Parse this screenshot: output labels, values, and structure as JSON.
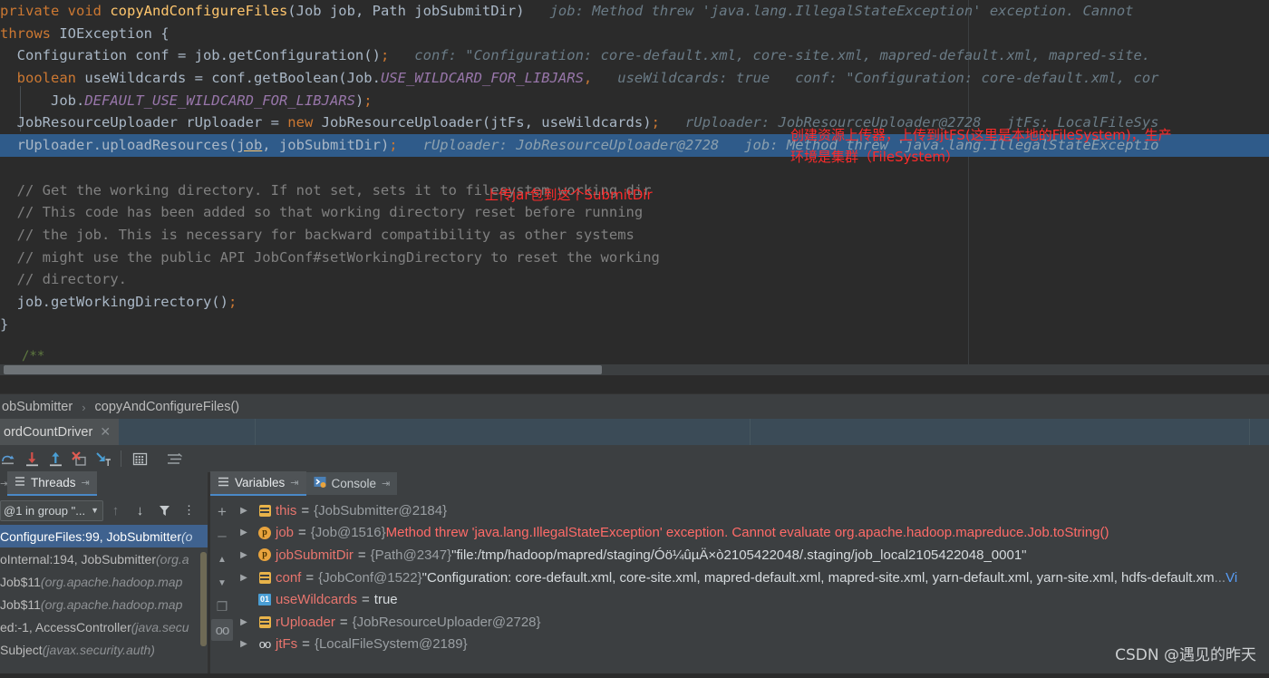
{
  "editor": {
    "lines": [
      {
        "segments": [
          {
            "t": "kw",
            "v": "private void "
          },
          {
            "t": "id",
            "v": "copyAndConfigureFiles"
          },
          {
            "t": "plain",
            "v": "(Job job, Path jobSubmitDir)"
          }
        ],
        "hint": "job: Method threw 'java.lang.IllegalStateException' exception. Cannot"
      },
      {
        "segments": [
          {
            "t": "kw",
            "v": "throws "
          },
          {
            "t": "plain",
            "v": "IOException {"
          }
        ],
        "hint": ""
      },
      {
        "segments": [
          {
            "t": "plain",
            "v": "  Configuration conf = job.getConfiguration()"
          },
          {
            "t": "semi",
            "v": ";"
          }
        ],
        "hint": "conf: \"Configuration: core-default.xml, core-site.xml, mapred-default.xml, mapred-site."
      },
      {
        "segments": [
          {
            "t": "kw",
            "v": "  boolean "
          },
          {
            "t": "plain",
            "v": "useWildcards = conf.getBoolean(Job."
          },
          {
            "t": "stat",
            "v": "USE_WILDCARD_FOR_LIBJARS"
          },
          {
            "t": "semi",
            "v": ","
          }
        ],
        "hint": "useWildcards: true   conf: \"Configuration: core-default.xml, cor"
      },
      {
        "segments": [
          {
            "t": "plain",
            "v": "      Job."
          },
          {
            "t": "stat",
            "v": "DEFAULT_USE_WILDCARD_FOR_LIBJARS"
          },
          {
            "t": "plain",
            "v": ")"
          },
          {
            "t": "semi",
            "v": ";"
          }
        ],
        "hint": ""
      },
      {
        "segments": [
          {
            "t": "plain",
            "v": "  JobResourceUploader rUploader = "
          },
          {
            "t": "kw",
            "v": "new "
          },
          {
            "t": "plain",
            "v": "JobResourceUploader(jtFs, useWildcards)"
          },
          {
            "t": "semi",
            "v": ";"
          }
        ],
        "hint": "rUploader: JobResourceUploader@2728   jtFs: LocalFileSys"
      },
      {
        "segments": [
          {
            "t": "plain",
            "v": "  rUploader.uploadResources("
          },
          {
            "t": "und",
            "v": "job"
          },
          {
            "t": "plain",
            "v": ", jobSubmitDir)"
          },
          {
            "t": "semi",
            "v": ";"
          }
        ],
        "hint": "rUploader: JobResourceUploader@2728   job: Method threw 'java.lang.IllegalStateExceptio",
        "highlight": true
      },
      {
        "segments": [
          {
            "t": "plain",
            "v": ""
          }
        ],
        "hint": ""
      },
      {
        "segments": [
          {
            "t": "cmt",
            "v": "  // Get the working directory. If not set, sets it to filesystem working dir"
          }
        ],
        "hint": ""
      },
      {
        "segments": [
          {
            "t": "cmt",
            "v": "  // This code has been added so that working directory reset before running"
          }
        ],
        "hint": ""
      },
      {
        "segments": [
          {
            "t": "cmt",
            "v": "  // the job. This is necessary for backward compatibility as other systems"
          }
        ],
        "hint": ""
      },
      {
        "segments": [
          {
            "t": "cmt",
            "v": "  // might use the public API JobConf#setWorkingDirectory to reset the working"
          }
        ],
        "hint": ""
      },
      {
        "segments": [
          {
            "t": "cmt",
            "v": "  // directory."
          }
        ],
        "hint": ""
      },
      {
        "segments": [
          {
            "t": "plain",
            "v": "  job.getWorkingDirectory()"
          },
          {
            "t": "semi",
            "v": ";"
          }
        ],
        "hint": ""
      },
      {
        "segments": [
          {
            "t": "plain",
            "v": "}"
          }
        ],
        "hint": ""
      }
    ],
    "ghost_comment": "/**",
    "annotations": [
      {
        "name": "annotation-create-uploader",
        "text": "创建资源上传器，上传到jtFS(这里是本地的FileSystem)，生产\n环境是集群（FileSystem）",
        "color": "#fd2b2b"
      },
      {
        "name": "annotation-upload-jar",
        "text": "上传jar包到这个SubmitDir",
        "color": "#fd2b2b"
      }
    ]
  },
  "breadcrumb": {
    "class_name": "obSubmitter",
    "separator": "›",
    "method_name": "copyAndConfigureFiles()"
  },
  "tabs": {
    "items": [
      {
        "label": "ordCountDriver",
        "close": "✕",
        "active": true
      }
    ]
  },
  "debug_toolbar": {
    "buttons": [
      {
        "name": "step-over-icon",
        "label": "step over"
      },
      {
        "name": "step-into-icon",
        "label": "step into"
      },
      {
        "name": "step-out-icon",
        "label": "step out"
      },
      {
        "name": "drop-frame-icon",
        "label": "drop frame"
      },
      {
        "name": "run-to-cursor-icon",
        "label": "run to cursor"
      },
      {
        "name": "evaluate-expression-icon",
        "label": "evaluate expression"
      },
      {
        "name": "settings-lines-icon",
        "label": "layout settings"
      }
    ]
  },
  "frames_panel": {
    "tab_label": "Threads",
    "tab_pin": "⇥",
    "thread_selector": "@1 in group \"...",
    "controls": [
      {
        "name": "frame-up-button",
        "glyph": "↑"
      },
      {
        "name": "frame-down-button",
        "glyph": "↓"
      },
      {
        "name": "filter-frames-button",
        "glyph": "▼"
      }
    ],
    "frames": [
      {
        "method": "ConfigureFiles:99, JobSubmitter",
        "pkg": "(o",
        "selected": true
      },
      {
        "method": "oInternal:194, JobSubmitter",
        "pkg": "(org.a",
        "selected": false
      },
      {
        "method": "Job$11",
        "pkg": "(org.apache.hadoop.map",
        "selected": false
      },
      {
        "method": "Job$11",
        "pkg": "(org.apache.hadoop.map",
        "selected": false
      },
      {
        "method": "ed:-1, AccessController",
        "pkg": "(java.secu",
        "selected": false
      },
      {
        "method": "Subject",
        "pkg": "(javax.security.auth)",
        "selected": false
      }
    ]
  },
  "variables_panel": {
    "tabs": [
      {
        "label": "Variables",
        "pin": "⇥",
        "active": true,
        "icon": "variables-icon"
      },
      {
        "label": "Console",
        "pin": "⇥",
        "active": false,
        "icon": "console-icon"
      }
    ],
    "gutter_buttons": [
      {
        "name": "add-watch-button",
        "glyph": "+"
      },
      {
        "name": "remove-watch-button",
        "glyph": "–"
      },
      {
        "name": "move-up-button",
        "glyph": "▲"
      },
      {
        "name": "move-down-button",
        "glyph": "▼"
      },
      {
        "name": "copy-value-button",
        "glyph": "❐"
      },
      {
        "name": "inspect-button",
        "glyph": "ᴏᴏ"
      }
    ],
    "rows": [
      {
        "expandable": true,
        "icon": "object-icon",
        "name": "this",
        "ref": "{JobSubmitter@2184}",
        "value": "",
        "value_class": "val"
      },
      {
        "expandable": true,
        "icon": "parameter-icon",
        "name": "job",
        "ref": "{Job@1516}",
        "value": "Method threw 'java.lang.IllegalStateException' exception. Cannot evaluate org.apache.hadoop.mapreduce.Job.toString()",
        "value_class": "err"
      },
      {
        "expandable": true,
        "icon": "parameter-icon",
        "name": "jobSubmitDir",
        "ref": "{Path@2347}",
        "value": "\"file:/tmp/hadoop/mapred/staging/Óö¼ûµÄ×ò2105422048/.staging/job_local2105422048_0001\"",
        "value_class": "val"
      },
      {
        "expandable": true,
        "icon": "object-icon",
        "name": "conf",
        "ref": "{JobConf@1522}",
        "value": "\"Configuration: core-default.xml, core-site.xml, mapred-default.xml, mapred-site.xml, yarn-default.xml, yarn-site.xml, hdfs-default.xm",
        "value_class": "val",
        "ellipsis": " ... ",
        "link": "Vi"
      },
      {
        "expandable": false,
        "icon": "boolean-icon",
        "name": "useWildcards",
        "ref": "",
        "value": "true",
        "value_class": "bool"
      },
      {
        "expandable": true,
        "icon": "object-icon",
        "name": "rUploader",
        "ref": "{JobResourceUploader@2728}",
        "value": "",
        "value_class": "val"
      },
      {
        "expandable": true,
        "icon": "glasses-icon",
        "name": "jtFs",
        "ref": "{LocalFileSystem@2189}",
        "value": "",
        "value_class": "val"
      }
    ]
  },
  "watermark": "CSDN @遇见的昨天",
  "colors": {
    "editor_bg": "#2b2b2b",
    "panel_bg": "#3c3f41",
    "selection_blue": "#2f5b8a",
    "frame_selected": "#3f628f",
    "accent_tab": "#4a88c7",
    "keyword": "#cc7832",
    "identifier": "#ffc66d",
    "static_field": "#9876aa",
    "comment": "#808080",
    "inlay_hint": "#6a7b86",
    "annotation_red": "#fd2b2b",
    "var_name": "#e8756e",
    "error_red": "#ff6b68",
    "link_blue": "#589df6"
  }
}
